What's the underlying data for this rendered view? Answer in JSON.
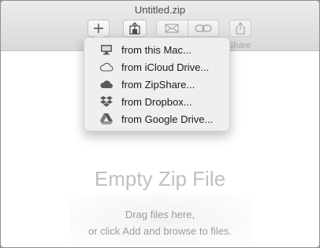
{
  "window": {
    "title": "Untitled.zip"
  },
  "toolbar": {
    "add_icon": "plus-icon",
    "extract_icon": "extract-icon",
    "mail_icon": "mail-icon",
    "link_icon": "link-icon",
    "share_icon": "share-icon",
    "share_label": "Share"
  },
  "add_menu": {
    "items": [
      {
        "label": "from this Mac...",
        "icon": "computer-icon"
      },
      {
        "label": "from iCloud Drive...",
        "icon": "cloud-outline-icon"
      },
      {
        "label": "from ZipShare...",
        "icon": "cloud-filled-icon"
      },
      {
        "label": "from Dropbox...",
        "icon": "dropbox-icon"
      },
      {
        "label": "from Google Drive...",
        "icon": "google-drive-icon"
      }
    ]
  },
  "content": {
    "title": "Empty Zip File",
    "hint_line1": "Drag files here,",
    "hint_line2": "or click Add and browse to files."
  }
}
